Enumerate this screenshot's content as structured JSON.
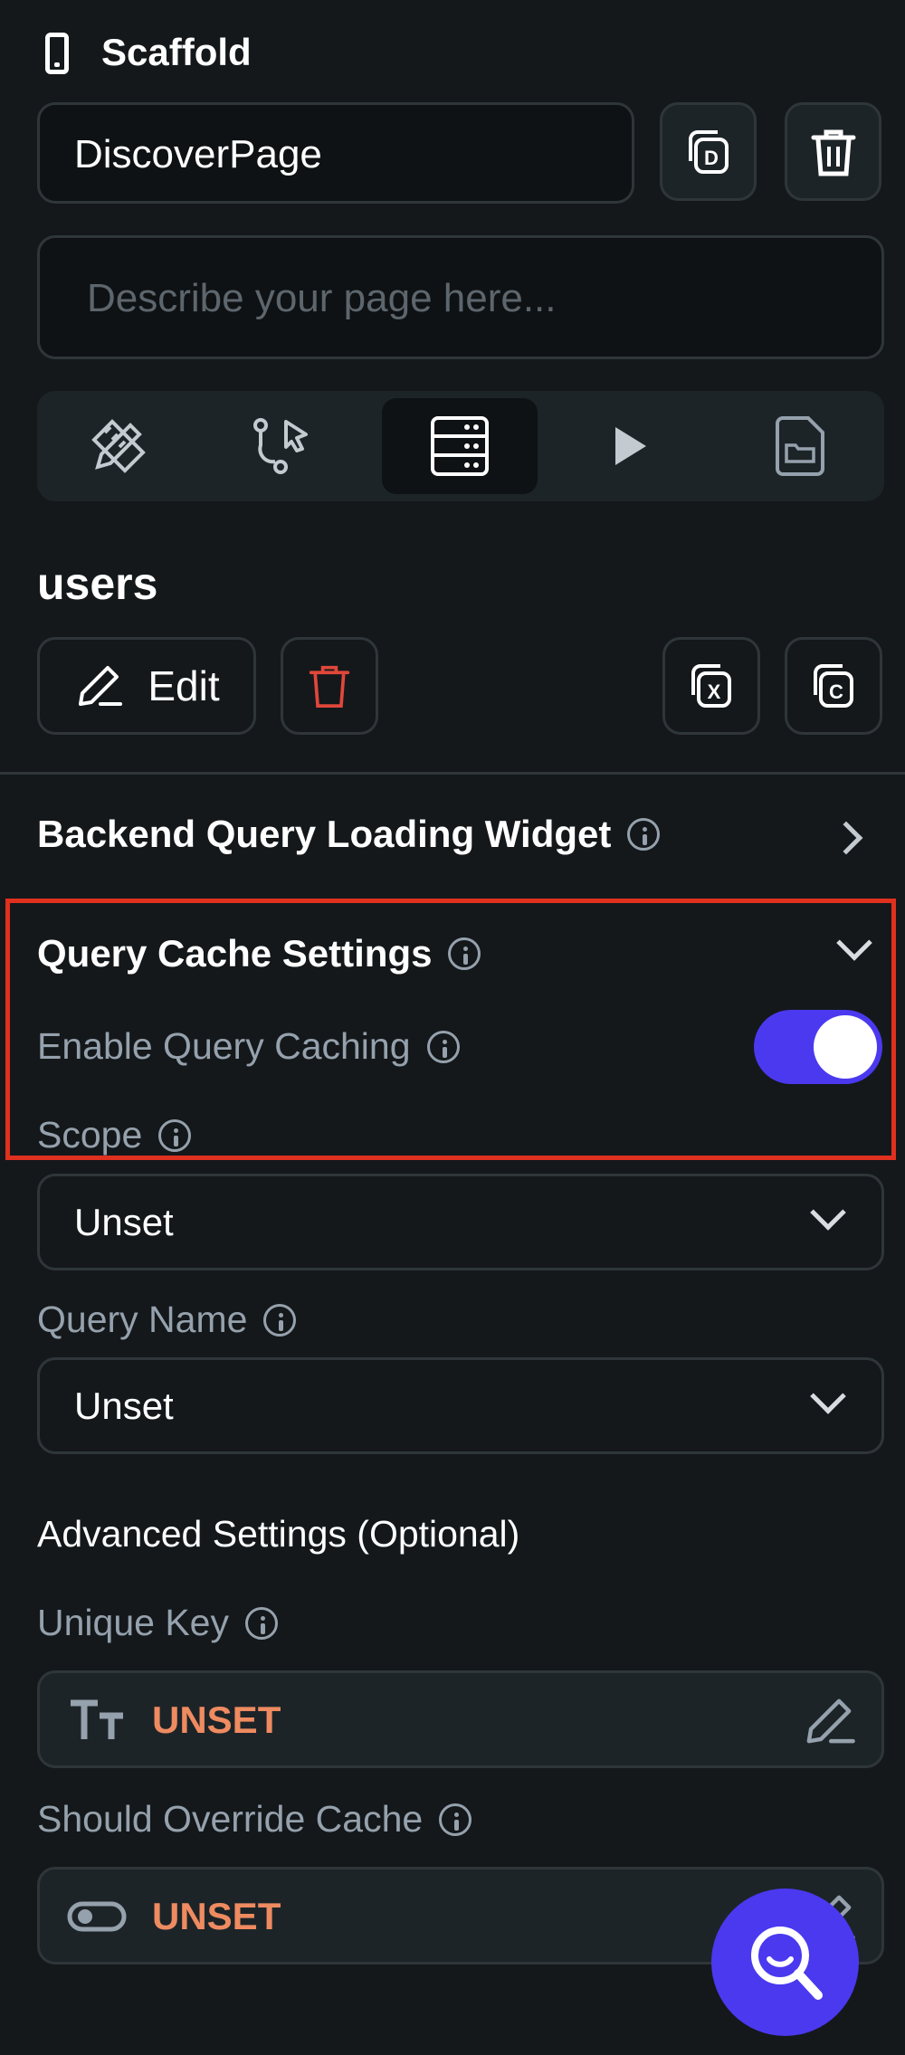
{
  "header": {
    "title": "Scaffold",
    "page_name": "DiscoverPage",
    "description_placeholder": "Describe your page here..."
  },
  "tabs": [
    {
      "name": "design-tab",
      "icon": "ruler-pencil-icon"
    },
    {
      "name": "actions-tab",
      "icon": "flow-cursor-icon"
    },
    {
      "name": "backend-query-tab",
      "icon": "server-icon",
      "active": true
    },
    {
      "name": "run-tab",
      "icon": "play-icon"
    },
    {
      "name": "files-tab",
      "icon": "folder-file-icon"
    }
  ],
  "query": {
    "name": "users",
    "edit_label": "Edit"
  },
  "loading_widget": {
    "label": "Backend Query Loading Widget"
  },
  "cache_settings": {
    "title": "Query Cache Settings",
    "enable_label": "Enable Query Caching",
    "enable_value": true,
    "scope_label": "Scope",
    "scope_value": "Unset",
    "query_name_label": "Query Name",
    "query_name_value": "Unset"
  },
  "advanced": {
    "title": "Advanced Settings (Optional)",
    "unique_key_label": "Unique Key",
    "unique_key_value": "UNSET",
    "override_label": "Should Override Cache",
    "override_value": "UNSET"
  },
  "colors": {
    "background": "#14181b",
    "accent": "#4b39ef",
    "unset_text": "#ee8b60",
    "delete_red": "#e0473a",
    "highlight": "#e0301e"
  }
}
